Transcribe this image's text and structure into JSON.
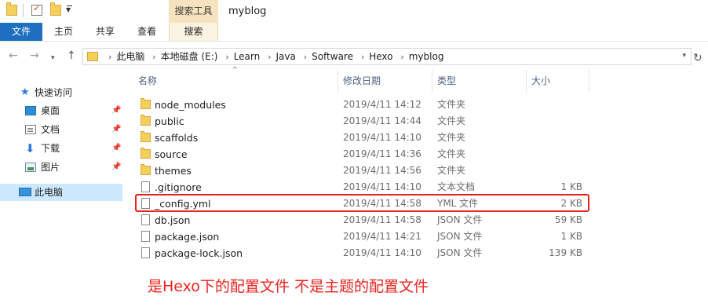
{
  "window": {
    "title": "myblog",
    "context_tab_header": "搜索工具"
  },
  "ribbon": {
    "tabs": [
      {
        "label": "文件"
      },
      {
        "label": "主页"
      },
      {
        "label": "共享"
      },
      {
        "label": "查看"
      },
      {
        "label": "搜索"
      }
    ]
  },
  "address": {
    "breadcrumbs": [
      "此电脑",
      "本地磁盘 (E:)",
      "Learn",
      "Java",
      "Software",
      "Hexo",
      "myblog"
    ]
  },
  "navpane": {
    "quick_access": "快速访问",
    "pinned": [
      {
        "label": "桌面",
        "icon": "desktop-icon"
      },
      {
        "label": "文档",
        "icon": "document-icon"
      },
      {
        "label": "下载",
        "icon": "download-icon"
      },
      {
        "label": "图片",
        "icon": "picture-icon"
      }
    ],
    "this_pc": "此电脑"
  },
  "columns": {
    "name": "名称",
    "modified": "修改日期",
    "type": "类型",
    "size": "大小"
  },
  "files": [
    {
      "name": "node_modules",
      "modified": "2019/4/11 14:12",
      "type": "文件夹",
      "size": "",
      "kind": "folder"
    },
    {
      "name": "public",
      "modified": "2019/4/11 14:44",
      "type": "文件夹",
      "size": "",
      "kind": "folder"
    },
    {
      "name": "scaffolds",
      "modified": "2019/4/11 14:10",
      "type": "文件夹",
      "size": "",
      "kind": "folder"
    },
    {
      "name": "source",
      "modified": "2019/4/11 14:36",
      "type": "文件夹",
      "size": "",
      "kind": "folder"
    },
    {
      "name": "themes",
      "modified": "2019/4/11 14:56",
      "type": "文件夹",
      "size": "",
      "kind": "folder"
    },
    {
      "name": ".gitignore",
      "modified": "2019/4/11 14:10",
      "type": "文本文档",
      "size": "1 KB",
      "kind": "file"
    },
    {
      "name": "_config.yml",
      "modified": "2019/4/11 14:58",
      "type": "YML 文件",
      "size": "2 KB",
      "kind": "file"
    },
    {
      "name": "db.json",
      "modified": "2019/4/11 14:58",
      "type": "JSON 文件",
      "size": "59 KB",
      "kind": "file"
    },
    {
      "name": "package.json",
      "modified": "2019/4/11 14:21",
      "type": "JSON 文件",
      "size": "1 KB",
      "kind": "file"
    },
    {
      "name": "package-lock.json",
      "modified": "2019/4/11 14:10",
      "type": "JSON 文件",
      "size": "139 KB",
      "kind": "file"
    }
  ],
  "annotation": "是Hexo下的配置文件 不是主题的配置文件",
  "colors": {
    "file_tab": "#1f6fc1",
    "context_tab": "#f6e3bd",
    "selected_nav": "#cce8ff",
    "annotation_red": "#e8231f"
  }
}
